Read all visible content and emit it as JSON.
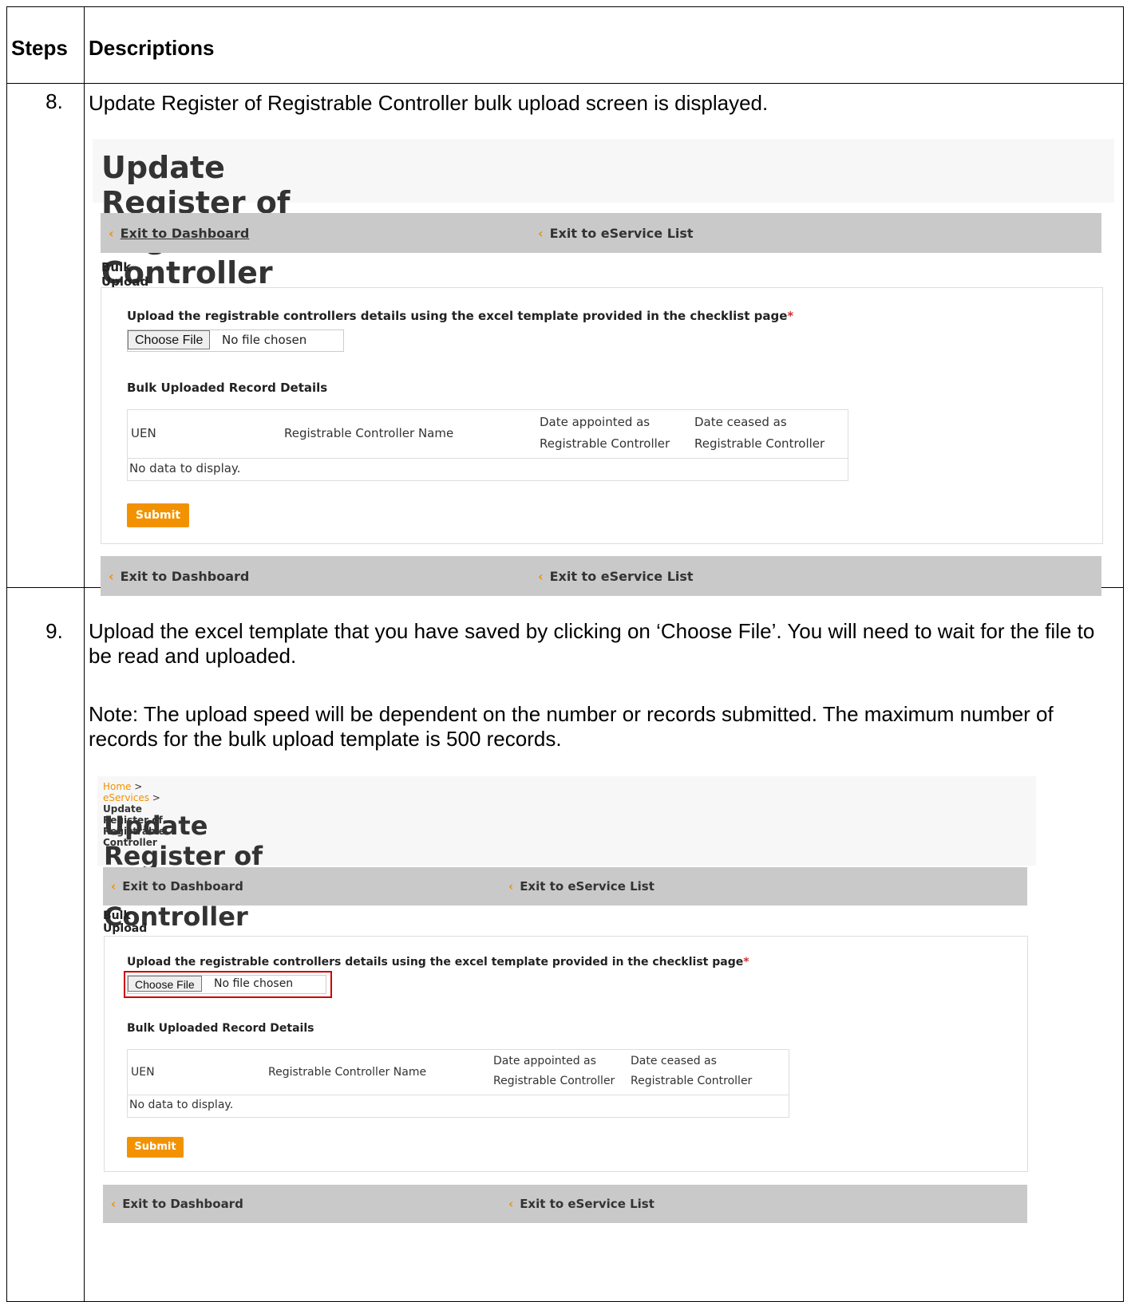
{
  "table": {
    "col_steps": "Steps",
    "col_desc": "Descriptions"
  },
  "step8": {
    "num": "8.",
    "text": "Update Register of Registrable Controller bulk upload screen is displayed."
  },
  "step9": {
    "num": "9.",
    "text1": "Upload the excel template that you have saved by clicking on ‘Choose File’. You will need to wait for the file to be read and uploaded.",
    "text2": "Note: The upload speed will be dependent on the number or records submitted. The maximum number of records for the bulk upload template is 500 records."
  },
  "screen": {
    "title": "Update Register of Registrable Controller",
    "nav_dashboard": "Exit to Dashboard",
    "nav_eservice": "Exit to eService List",
    "section": "Bulk Upload",
    "upload_label": "Upload the registrable controllers details using the excel template provided in the checklist page",
    "required_mark": "*",
    "choose_file": "Choose File",
    "no_file": "No file chosen",
    "records_heading": "Bulk Uploaded Record Details",
    "columns": [
      "UEN",
      "Registrable Controller Name",
      "Date appointed as",
      "Registrable Controller",
      "Date ceased as",
      "Registrable Controller"
    ],
    "empty": "No data to display.",
    "submit": "Submit",
    "chevron": "‹"
  },
  "breadcrumb": {
    "home": "Home",
    "sep1": " > ",
    "eservices": "eServices",
    "sep2": " > ",
    "current": "Update Register of Registrable Controller"
  }
}
